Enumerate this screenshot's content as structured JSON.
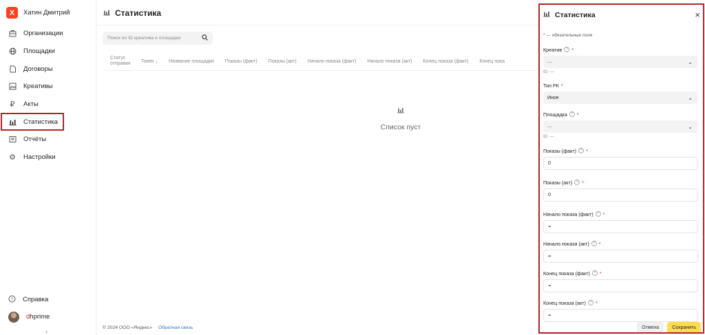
{
  "user": {
    "logo_letter": "X",
    "name": "Хатин Дмитрий"
  },
  "sidebar": {
    "items": [
      {
        "label": "Организации",
        "icon": "building-icon"
      },
      {
        "label": "Площадки",
        "icon": "globe-icon"
      },
      {
        "label": "Договоры",
        "icon": "document-icon"
      },
      {
        "label": "Креативы",
        "icon": "image-icon"
      },
      {
        "label": "Акты",
        "icon": "ruble-icon"
      },
      {
        "label": "Статистика",
        "icon": "chart-icon",
        "active": true
      },
      {
        "label": "Отчёты",
        "icon": "report-icon"
      },
      {
        "label": "Настройки",
        "icon": "gear-icon"
      }
    ],
    "help_label": "Справка",
    "username_first": "d",
    "username_rest": "hprime"
  },
  "main": {
    "title": "Статистика",
    "search_placeholder": "Поиск по ID креатива и площадки",
    "columns": [
      "Статус отправки",
      "Токен",
      "Название площадки",
      "Показы (факт)",
      "Показы (акт)",
      "Начало показа (факт)",
      "Начало показа (акт)",
      "Конец показа (факт)",
      "Конец пока"
    ],
    "empty_text": "Список пуст",
    "footer_copyright": "© 2024 ООО «Яндекс»",
    "footer_link": "Обратная связь"
  },
  "panel": {
    "title": "Статистика",
    "required_note": "— обязательные поля",
    "creative": {
      "label": "Креатив",
      "value": "—",
      "id_line": "ID: —"
    },
    "campaign_type": {
      "label": "Тип РК",
      "value": "Иное"
    },
    "platform": {
      "label": "Площадка",
      "value": "—",
      "id_line": "ID: —"
    },
    "impressions_fact": {
      "label": "Показы (факт)",
      "value": "0"
    },
    "impressions_act": {
      "label": "Показы (акт)",
      "value": "0"
    },
    "start_fact": {
      "label": "Начало показа (факт)"
    },
    "start_act": {
      "label": "Начало показа (акт)"
    },
    "end_fact": {
      "label": "Конец показа (факт)"
    },
    "end_act": {
      "label": "Конец показа (акт)"
    },
    "cancel_label": "Отмена",
    "save_label": "Сохранить"
  },
  "colors": {
    "accent": "#fc3f1d",
    "highlight": "#b52028",
    "save_button": "#ffdb4d"
  }
}
